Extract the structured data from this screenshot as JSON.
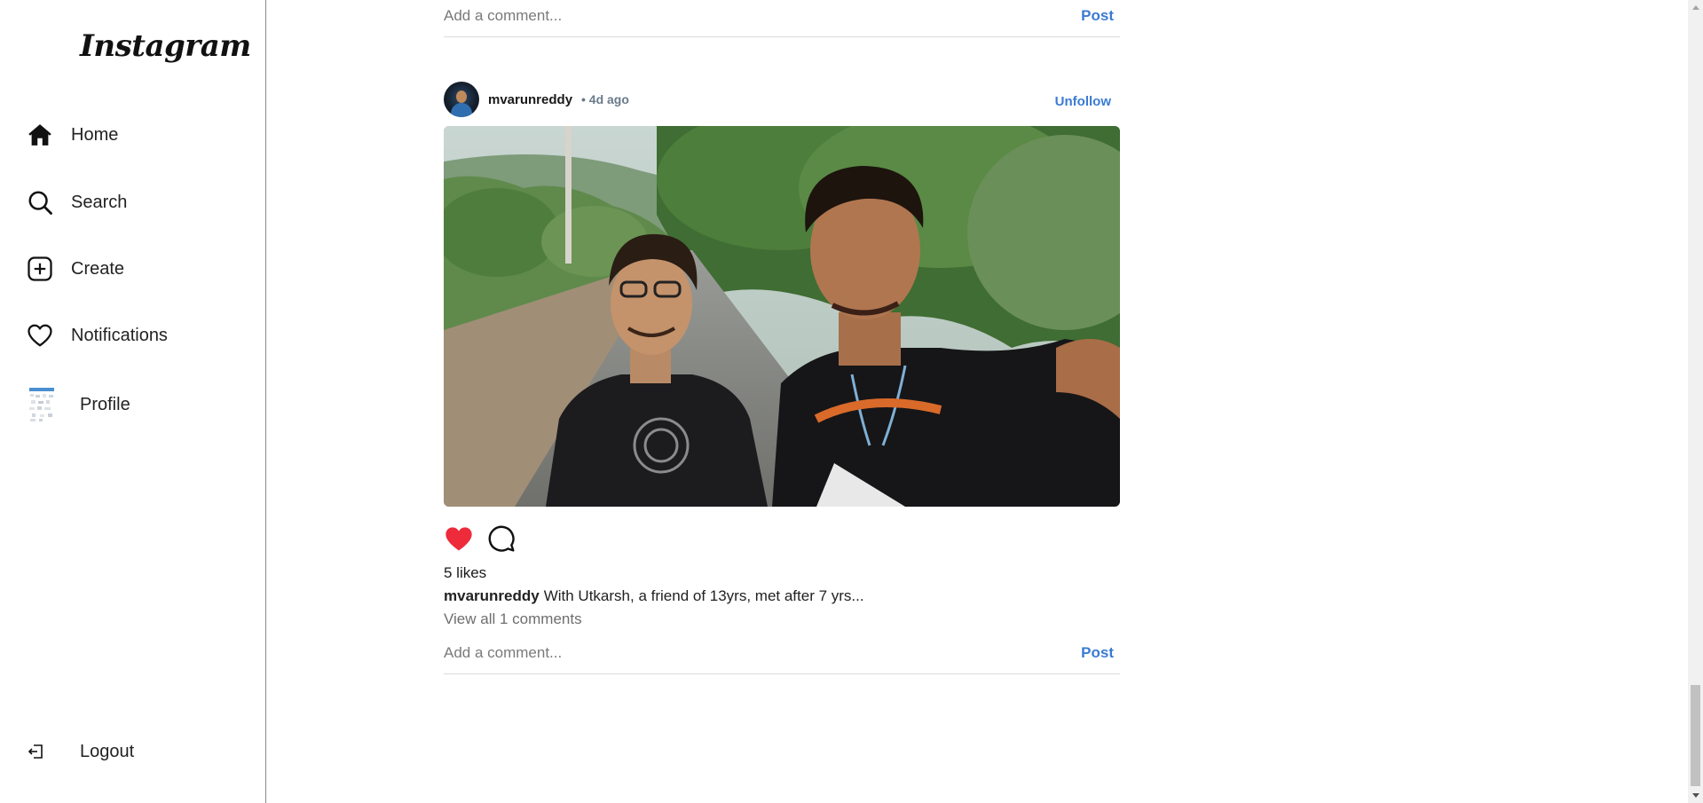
{
  "sidebar": {
    "logo": "Instagram",
    "items": [
      {
        "label": "Home",
        "icon": "home-icon"
      },
      {
        "label": "Search",
        "icon": "search-icon"
      },
      {
        "label": "Create",
        "icon": "plus-square-icon"
      },
      {
        "label": "Notifications",
        "icon": "heart-icon"
      },
      {
        "label": "Profile",
        "icon": "avatar"
      }
    ],
    "logout": {
      "label": "Logout",
      "icon": "logout-icon"
    }
  },
  "previous_post": {
    "comment_placeholder": "Add a comment...",
    "post_label": "Post"
  },
  "post": {
    "username": "mvarunreddy",
    "time": "• 4d ago",
    "follow_label": "Unfollow",
    "liked": true,
    "likes": "5 likes",
    "caption_user": "mvarunreddy",
    "caption_text": "With Utkarsh, a friend of 13yrs, met after 7 yrs...",
    "view_comments": "View all 1 comments",
    "comment_placeholder": "Add a comment...",
    "post_label": "Post"
  },
  "colors": {
    "accent": "#3b7bd4",
    "like": "#ed2b3a",
    "divider": "#8a8a8a"
  }
}
